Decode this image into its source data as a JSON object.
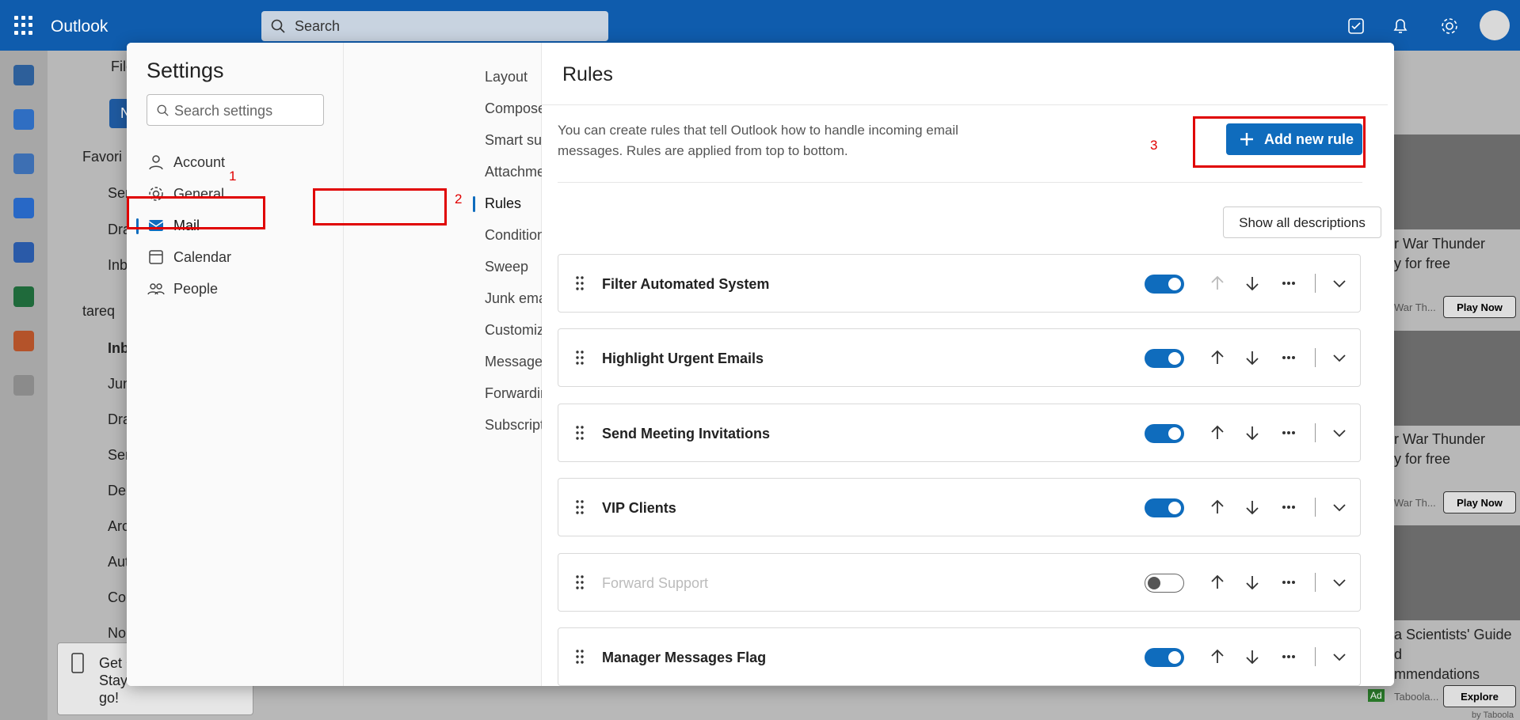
{
  "topbar": {
    "app_name": "Outlook",
    "search_placeholder": "Search"
  },
  "background": {
    "new_label": "New",
    "file_label": "File",
    "folders": [
      "Favori",
      "Sen",
      "Dra",
      "Inb",
      "tareq",
      "Inb",
      "Jun",
      "Dra",
      "Sen",
      "Del",
      "Arc",
      "Aut",
      "Co",
      "No"
    ],
    "ads": [
      {
        "title_line1": "r War Thunder",
        "title_line2": "y for free",
        "source": "War Th...",
        "button": "Play Now"
      },
      {
        "title_line1": "r War Thunder",
        "title_line2": "y for free",
        "source": "War Th...",
        "button": "Play Now"
      },
      {
        "title_line1": "a Scientists' Guide",
        "title_line2": "d",
        "title_line3": "mmendations",
        "source": "Taboola...",
        "button": "Explore",
        "badge": "Ad",
        "footer": "by Taboola"
      }
    ],
    "getapp": {
      "line1": "Get C",
      "line2": "Stay connected on the",
      "line3": "go!"
    }
  },
  "settings": {
    "title": "Settings",
    "search_placeholder": "Search settings",
    "categories": [
      {
        "label": "Account",
        "icon": "person-icon"
      },
      {
        "label": "General",
        "icon": "gear-icon"
      },
      {
        "label": "Mail",
        "icon": "mail-icon",
        "selected": true
      },
      {
        "label": "Calendar",
        "icon": "calendar-icon"
      },
      {
        "label": "People",
        "icon": "people-icon"
      }
    ],
    "mail_sections": [
      "Layout",
      "Compose and reply",
      "Smart suggestions",
      "Attachments",
      "Rules",
      "Conditional formatting",
      "Sweep",
      "Junk email",
      "Customize actions",
      "Message handling",
      "Forwarding and IMAP",
      "Subscriptions"
    ],
    "selected_section": "Rules"
  },
  "rules_panel": {
    "title": "Rules",
    "description": "You can create rules that tell Outlook how to handle incoming email messages. Rules are applied from top to bottom.",
    "add_button": "Add new rule",
    "show_all": "Show all descriptions",
    "rules": [
      {
        "name": "Filter Automated System",
        "enabled": true
      },
      {
        "name": "Highlight Urgent Emails",
        "enabled": true
      },
      {
        "name": "Send Meeting Invitations",
        "enabled": true
      },
      {
        "name": "VIP Clients",
        "enabled": true
      },
      {
        "name": "Forward Support",
        "enabled": false
      },
      {
        "name": "Manager Messages Flag",
        "enabled": true
      }
    ]
  },
  "annotations": {
    "step1": "1",
    "step2": "2",
    "step3": "3"
  },
  "colors": {
    "accent": "#0f6cbd",
    "topbar": "#0f5cad",
    "annotation": "#e00000"
  }
}
